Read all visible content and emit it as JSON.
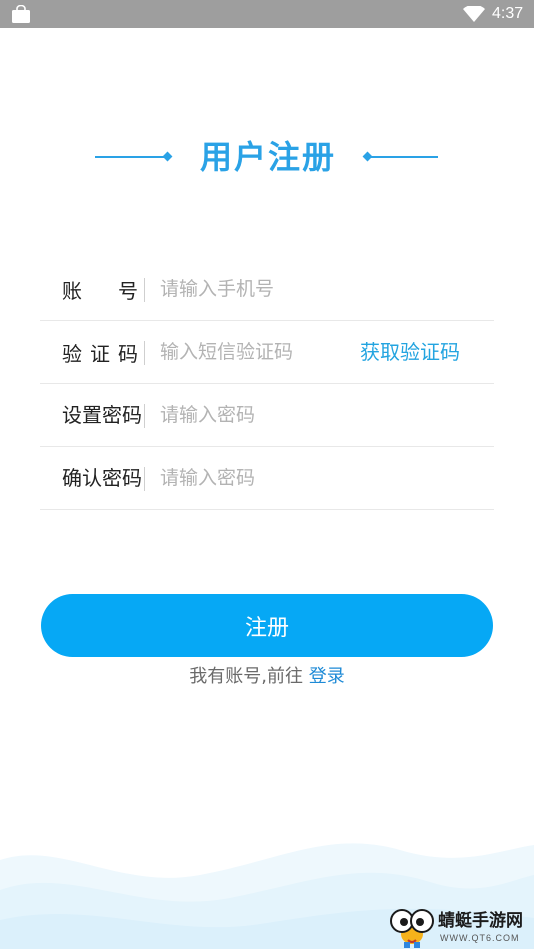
{
  "status_bar": {
    "time": "4:37",
    "icons": [
      "shopping-bag-icon",
      "wifi-icon"
    ]
  },
  "header": {
    "title": "用户注册"
  },
  "form": {
    "account": {
      "label_chars": [
        "账",
        "号"
      ],
      "placeholder": "请输入手机号",
      "value": ""
    },
    "code": {
      "label_chars": [
        "验",
        "证",
        "码"
      ],
      "placeholder": "输入短信验证码",
      "value": "",
      "get_code_label": "获取验证码"
    },
    "password": {
      "label": "设置密码",
      "placeholder": "请输入密码",
      "value": ""
    },
    "confirm": {
      "label": "确认密码",
      "placeholder": "请输入密码",
      "value": ""
    }
  },
  "actions": {
    "register_label": "注册",
    "login_prompt": "我有账号,前往",
    "login_link": "登录"
  },
  "watermark": {
    "name": "蜻蜓手游网",
    "url": "WWW.QT6.COM"
  },
  "colors": {
    "accent": "#2aa2e6",
    "button": "#06a8f5",
    "status_bar": "#9e9e9e",
    "link": "#23a4e0"
  }
}
